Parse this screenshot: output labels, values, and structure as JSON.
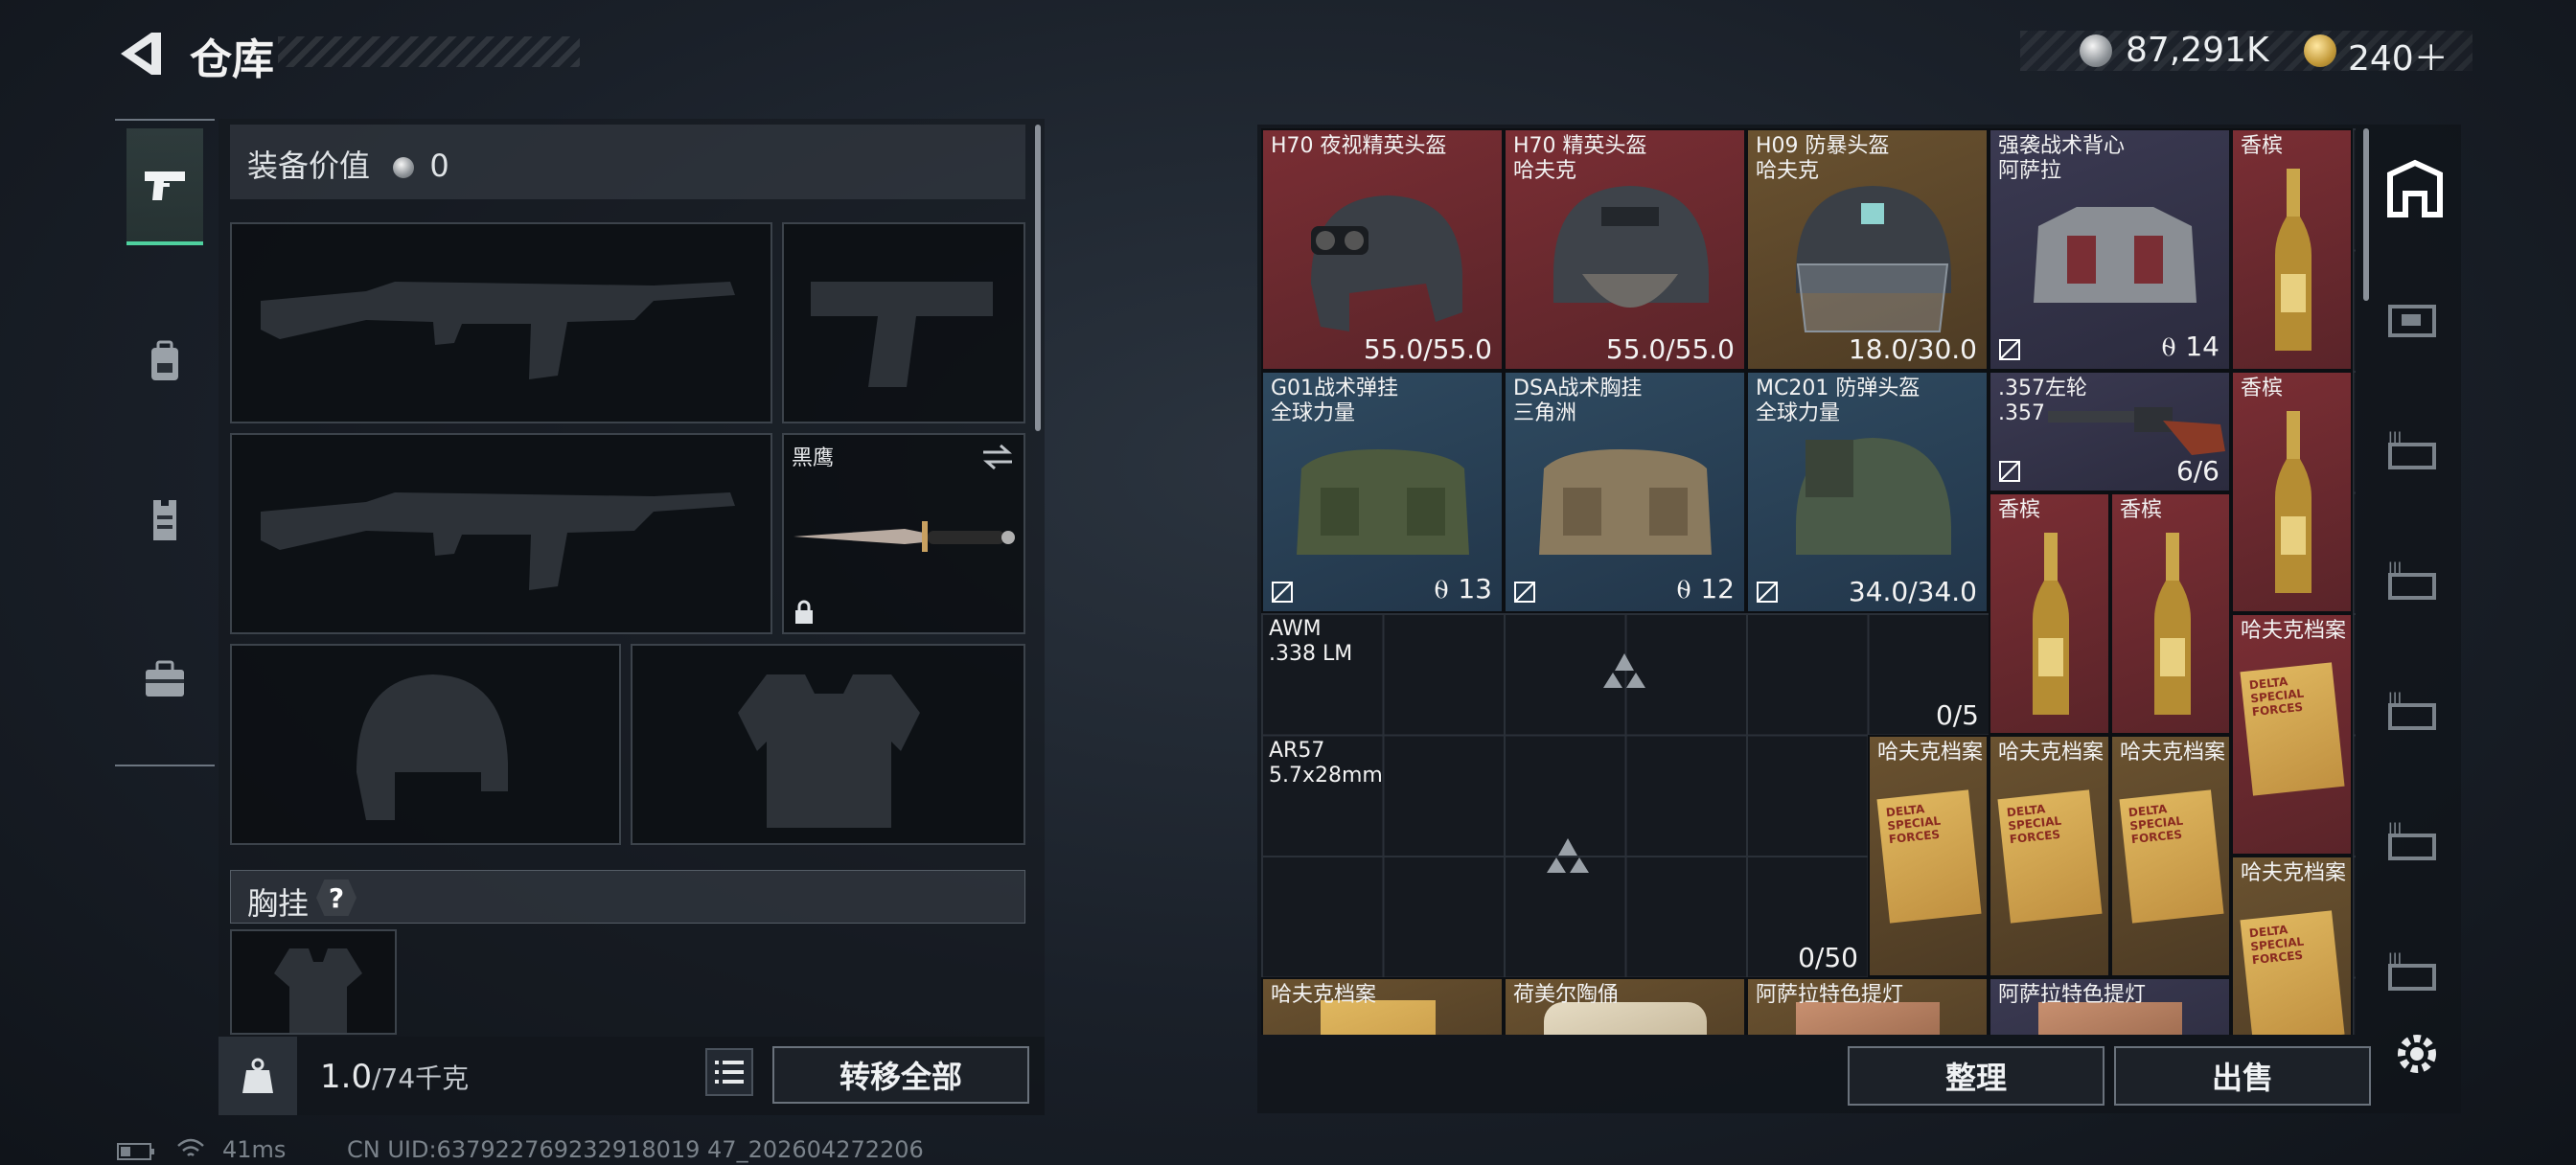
{
  "header": {
    "title": "仓库",
    "currency_silver": "87,291K",
    "currency_gold": "240＋"
  },
  "equip": {
    "value_label": "装备价值",
    "value": "0",
    "melee_name": "黑鹰",
    "chest_label": "胸挂",
    "chest_help": "?"
  },
  "bottom": {
    "weight": "1.0",
    "weight_max": "/74千克",
    "transfer_all": "转移全部",
    "sort": "整理",
    "sell": "出售"
  },
  "status": {
    "ping": "41ms",
    "uid": "CN UID:637922769232918019 47_202604272206"
  },
  "inventory": [
    {
      "name": "H70 夜视精英头盔",
      "sub": "",
      "dur": "55.0/55.0",
      "rarity": "red"
    },
    {
      "name": "H70 精英头盔",
      "sub": "哈夫克",
      "dur": "55.0/55.0",
      "rarity": "red"
    },
    {
      "name": "H09 防暴头盔",
      "sub": "哈夫克",
      "dur": "18.0/30.0",
      "rarity": "gold"
    },
    {
      "name": "强袭战术背心",
      "sub": "阿萨拉",
      "cnt": "14",
      "rarity": "purple"
    },
    {
      "name": "香槟",
      "rarity": "red"
    },
    {
      "name": "G01战术弹挂",
      "sub": "全球力量",
      "cnt": "13",
      "rarity": "blue"
    },
    {
      "name": "DSA战术胸挂",
      "sub": "三角洲",
      "cnt": "12",
      "rarity": "blue"
    },
    {
      "name": "MC201 防弹头盔",
      "sub": "全球力量",
      "dur": "34.0/34.0",
      "rarity": "blue"
    },
    {
      "name": ".357左轮",
      "sub": ".357",
      "dur": "6/6",
      "rarity": "purple"
    },
    {
      "name": "香槟",
      "rarity": "red"
    },
    {
      "name": "香槟",
      "rarity": "red"
    },
    {
      "name": "香槟",
      "rarity": "red"
    },
    {
      "name": "AWM",
      "sub": ".338 LM",
      "dur": "0/5",
      "rarity": "grey"
    },
    {
      "name": "哈夫克档案",
      "rarity": "red"
    },
    {
      "name": "AR57",
      "sub": "5.7x28mm",
      "dur": "0/50",
      "rarity": "grey"
    },
    {
      "name": "哈夫克档案",
      "rarity": "gold"
    },
    {
      "name": "哈夫克档案",
      "rarity": "gold"
    },
    {
      "name": "哈夫克档案",
      "rarity": "gold"
    },
    {
      "name": "哈夫克档案",
      "rarity": "gold"
    },
    {
      "name": "哈夫克档案",
      "rarity": "gold"
    },
    {
      "name": "荷美尔陶俑",
      "rarity": "gold"
    },
    {
      "name": "阿萨拉特色提灯",
      "rarity": "gold"
    },
    {
      "name": "阿萨拉特色提灯",
      "rarity": "purple"
    }
  ],
  "doc_cover_text": "DELTA SPECIAL FORCES",
  "colors": {
    "accent_green": "#4fd19f",
    "rarity_red": "#7a2e34",
    "rarity_gold": "#6a5230",
    "rarity_blue": "#2f4a60",
    "rarity_purple": "#3b3a52"
  }
}
